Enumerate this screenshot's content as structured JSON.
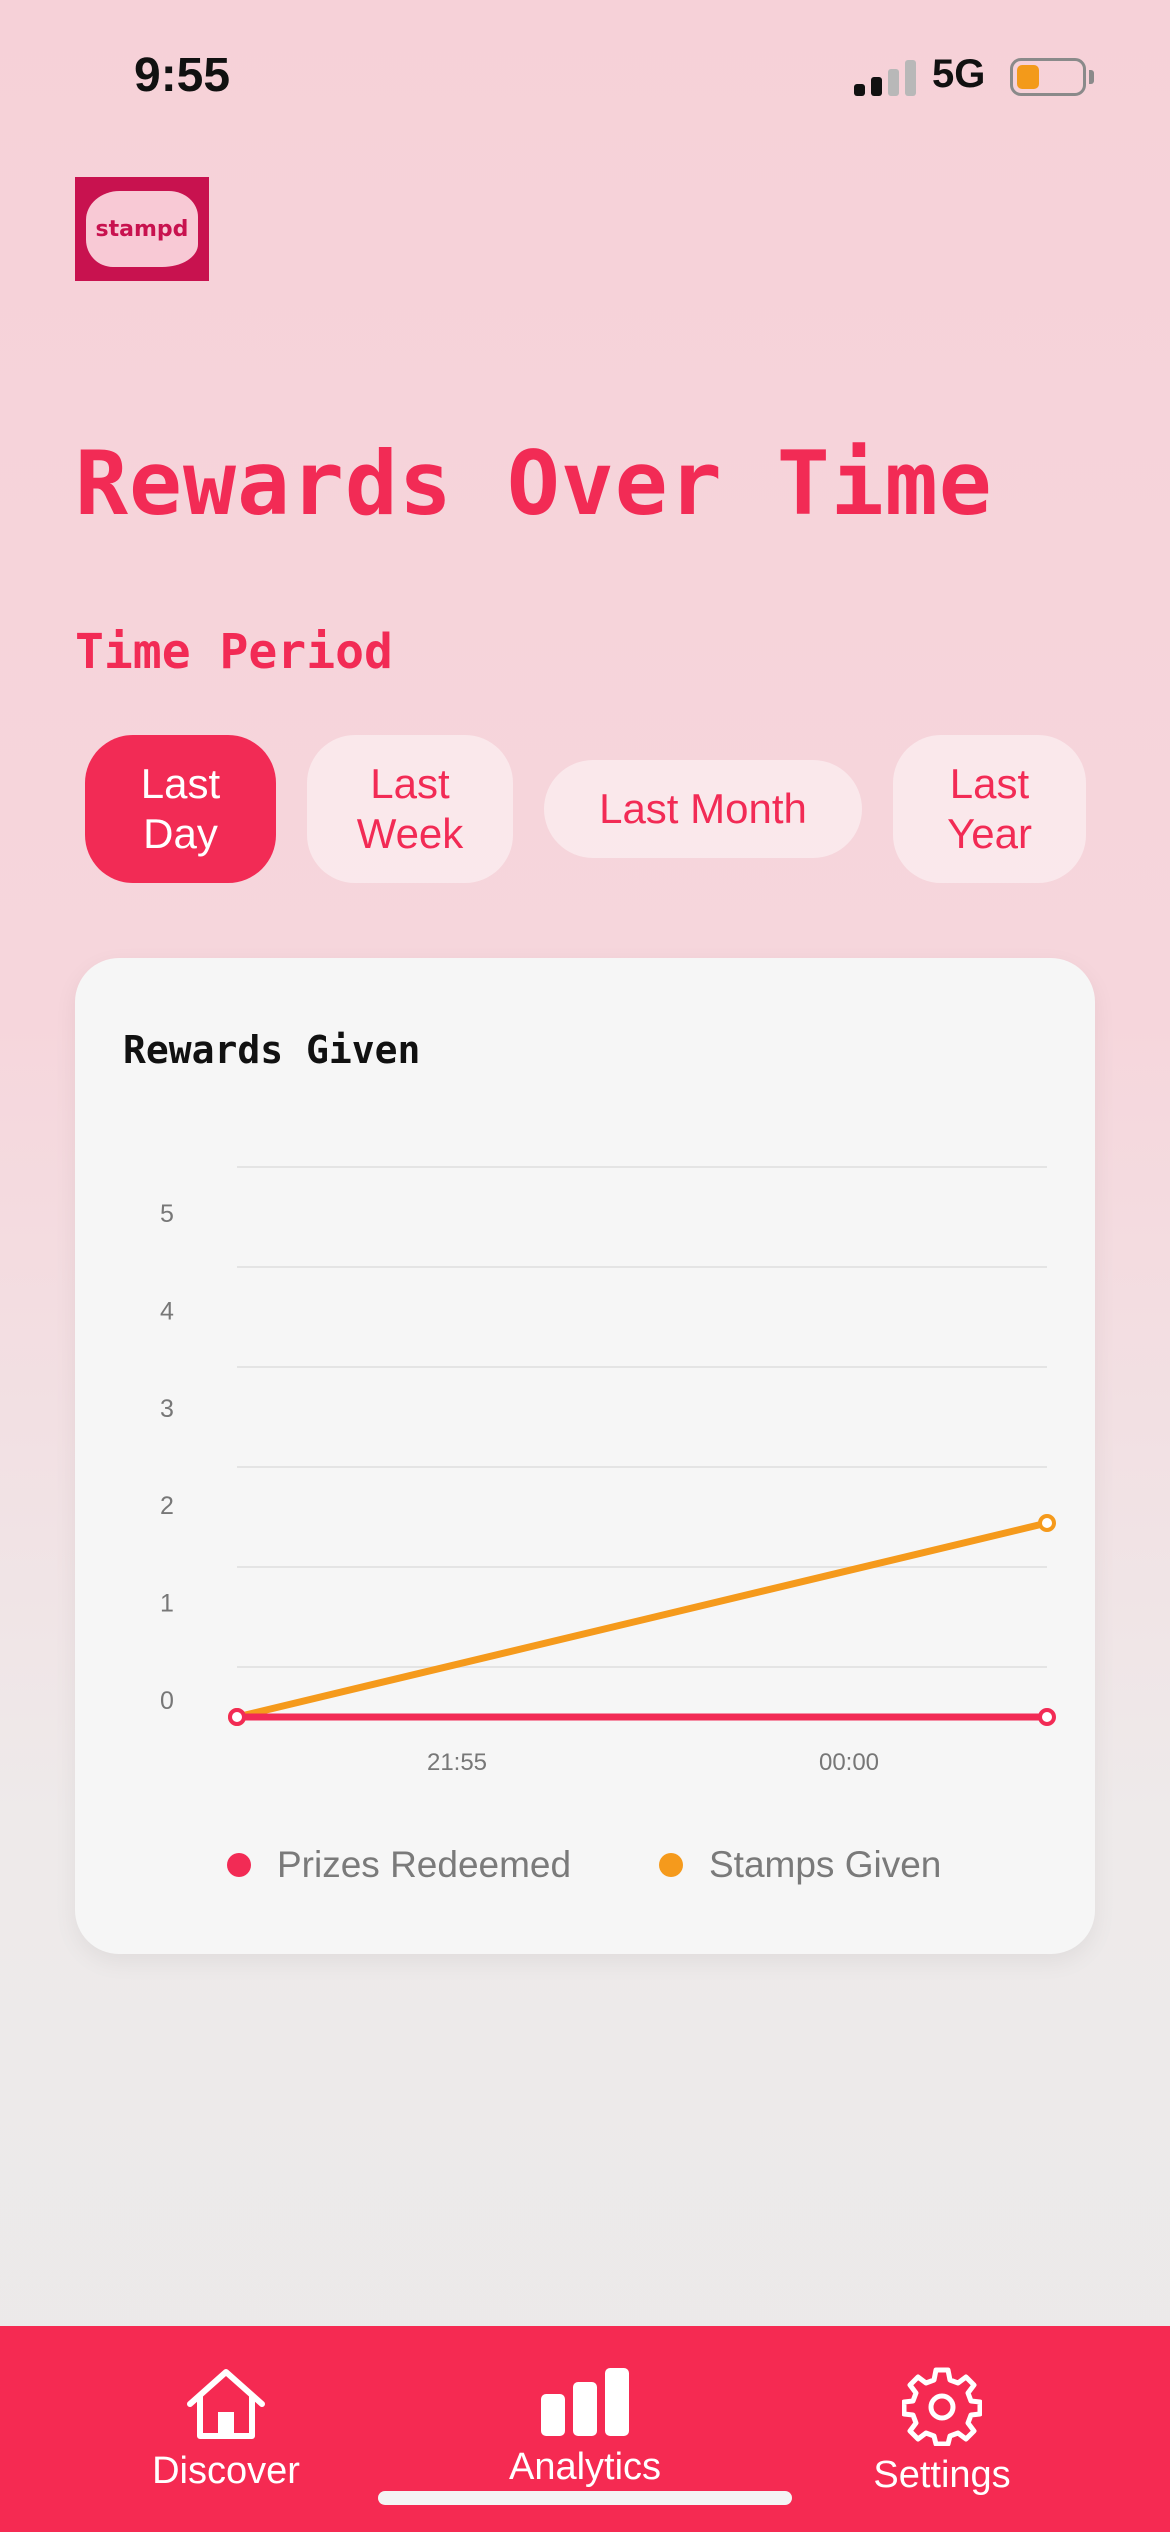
{
  "status_bar": {
    "time": "9:55",
    "network": "5G"
  },
  "logo": {
    "text": "stampd"
  },
  "page_title": "Rewards Over Time",
  "time_period": {
    "label": "Time Period",
    "options": [
      {
        "label": "Last\nDay",
        "active": true
      },
      {
        "label": "Last\nWeek",
        "active": false
      },
      {
        "label": "Last Month",
        "active": false
      },
      {
        "label": "Last\nYear",
        "active": false
      }
    ]
  },
  "chart_card": {
    "title": "Rewards Given"
  },
  "chart_data": {
    "type": "line",
    "title": "Rewards Given",
    "xlabel": "",
    "ylabel": "",
    "x_ticks": [
      "21:55",
      "00:00"
    ],
    "y_ticks": [
      0,
      1,
      2,
      3,
      4,
      5
    ],
    "ylim": [
      0,
      5
    ],
    "grid": true,
    "legend": "bottom",
    "series": [
      {
        "name": "Prizes Redeemed",
        "color": "#f22b55",
        "points": [
          {
            "x": "start",
            "y": 0
          },
          {
            "x": "end",
            "y": 0
          }
        ]
      },
      {
        "name": "Stamps Given",
        "color": "#f59a1c",
        "points": [
          {
            "x": "start",
            "y": 0
          },
          {
            "x": "end",
            "y": 2
          }
        ]
      }
    ]
  },
  "tab_bar": {
    "tabs": [
      {
        "label": "Discover",
        "icon": "house-icon"
      },
      {
        "label": "Analytics",
        "icon": "bar-chart-icon",
        "active": true
      },
      {
        "label": "Settings",
        "icon": "gear-icon"
      }
    ]
  },
  "colors": {
    "accent": "#f22b55",
    "stamps": "#f59a1c",
    "logo_bg": "#c8124f"
  }
}
